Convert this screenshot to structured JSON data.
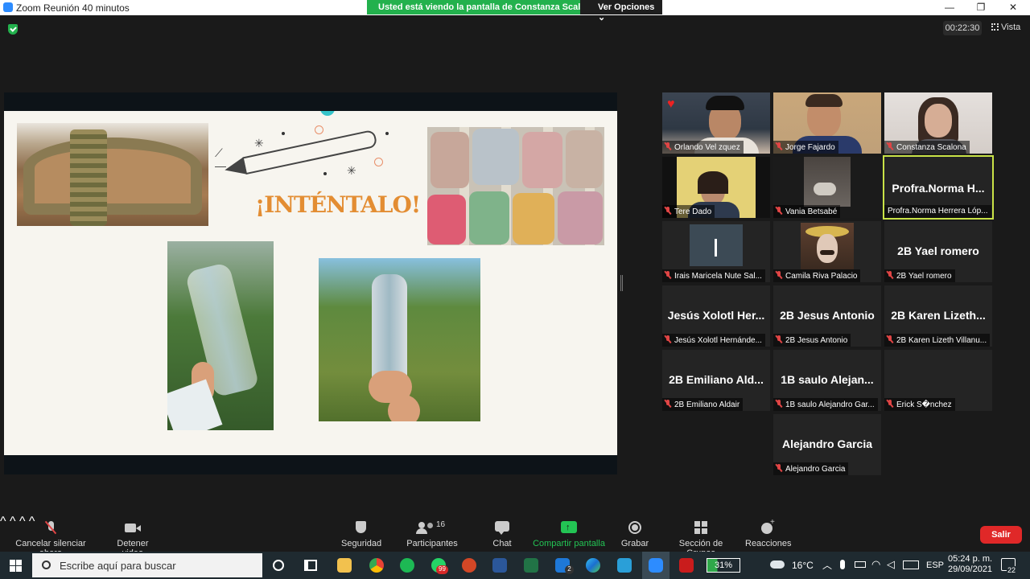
{
  "window": {
    "title": "Zoom Reunión 40 minutos",
    "banner_text": "Usted está viendo la pantalla de Constanza Scalona",
    "view_options": "Ver Opciones",
    "colors": {
      "banner": "#23b14d",
      "leave": "#e02828",
      "active_speaker": "#c9e247",
      "accent": "#2d8cff"
    }
  },
  "meeting": {
    "timer": "00:22:30",
    "view_label": "Vista"
  },
  "slide": {
    "title": "¡INTÉNTALO!"
  },
  "participants": [
    {
      "name": "Orlando Vel zquez",
      "video": true,
      "icon": "heart-icon"
    },
    {
      "name": "Jorge Fajardo",
      "video": true
    },
    {
      "name": "Constanza Scalona",
      "video": true
    },
    {
      "name": "Tere Dado",
      "video": true
    },
    {
      "name": "Vania Betsabé",
      "video": true
    },
    {
      "name": "Profra.Norma Herrera Lóp...",
      "display": "Profra.Norma H...",
      "active": true
    },
    {
      "name": "Irais Maricela Nute Sal...",
      "video": true
    },
    {
      "name": "Camila Riva Palacio",
      "video": true
    },
    {
      "name": "2B Yael romero",
      "display": "2B Yael romero"
    },
    {
      "name": "Jesús Xolotl Hernánde...",
      "display": "Jesús Xolotl Her..."
    },
    {
      "name": "2B Jesus Antonio",
      "display": "2B Jesus Antonio"
    },
    {
      "name": "2B Karen Lizeth Villanu...",
      "display": "2B Karen Lizeth..."
    },
    {
      "name": "2B Emiliano Aldair",
      "display": "2B Emiliano Ald..."
    },
    {
      "name": "1B saulo Alejandro Gar...",
      "display": "1B saulo Alejan..."
    },
    {
      "name": "Erick S�nchez",
      "display": ""
    },
    {
      "name": "Alejandro Garcia",
      "display": "Alejandro Garcia"
    }
  ],
  "toolbar": {
    "mute": "Cancelar silenciar ahora",
    "video": "Detener video",
    "security": "Seguridad",
    "participants": "Participantes",
    "participants_count": "16",
    "chat": "Chat",
    "share": "Compartir pantalla",
    "record": "Grabar",
    "breakout": "Sección de Grupos",
    "reactions": "Reacciones",
    "leave": "Salir"
  },
  "taskbar": {
    "search_placeholder": "Escribe aquí para buscar",
    "temperature": "16°C",
    "battery": "31%",
    "language": "ESP",
    "time": "05:24 p. m.",
    "date": "29/09/2021",
    "notifications": "22",
    "whatsapp_badge": "99",
    "mail_badge": "2"
  }
}
